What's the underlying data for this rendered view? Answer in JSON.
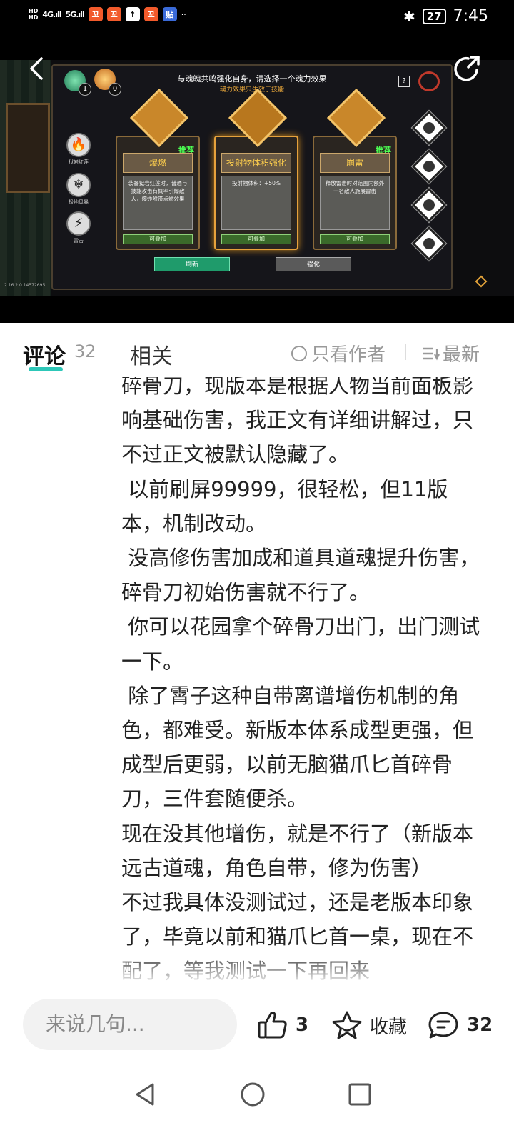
{
  "status_bar": {
    "net1": "4G",
    "net2": "5G",
    "battery": "27",
    "time": "7:45",
    "dots": "··"
  },
  "game": {
    "title": "与魂魄共鸣强化自身，请选择一个魂力效果",
    "subtitle": "魂力效果只生效于技能",
    "help": "?",
    "orb_green_count": "1",
    "orb_orange_count": "0",
    "skills": [
      {
        "label": "狱岩红莲",
        "icon": "🔥"
      },
      {
        "label": "极地风暴",
        "icon": "❄"
      },
      {
        "label": "雷击",
        "icon": "⚡"
      }
    ],
    "cards": [
      {
        "title": "爆燃",
        "tag": "推荐",
        "desc": "装备狱岩红莲时，普通与技能攻击有概率引爆敌人，爆炸附带点燃效果",
        "foot": "可叠加"
      },
      {
        "title": "投射物体积强化",
        "tag": "",
        "desc": "投射物体积：+50%",
        "foot": "可叠加"
      },
      {
        "title": "崩雷",
        "tag": "推荐",
        "desc": "释放雷击时对范围内额外一名敌人施展雷击",
        "foot": "可叠加"
      }
    ],
    "refresh_label": "刷新",
    "strengthen_label": "强化",
    "version": "2.16.2.0 14572695"
  },
  "tabs": {
    "comments_label": "评论",
    "comments_count": "32",
    "related_label": "相关",
    "author_only": "只看作者",
    "sort_label": "最新"
  },
  "comment": {
    "text": "碎骨刀，现版本是根据人物当前面板影响基础伤害，我正文有详细讲解过，只不过正文被默认隐藏了。\n 以前刷屏99999，很轻松，但11版本，机制改动。\n 没高修伤害加成和道具道魂提升伤害，碎骨刀初始伤害就不行了。\n 你可以花园拿个碎骨刀出门，出门测试一下。\n 除了霄子这种自带离谱增伤机制的角色，都难受。新版本体系成型更强，但成型后更弱，以前无脑猫爪匕首碎骨刀，三件套随便杀。\n现在没其他增伤，就是不行了（新版本远古道魂，角色自带，修为伤害）\n不过我具体没测试过，还是老版本印象了，毕竟以前和猫爪匕首一桌，现在不配了，等我测试一下再回来"
  },
  "actions": {
    "input_placeholder": "来说几句...",
    "like_count": "3",
    "favorite_label": "收藏",
    "comment_count": "32"
  }
}
